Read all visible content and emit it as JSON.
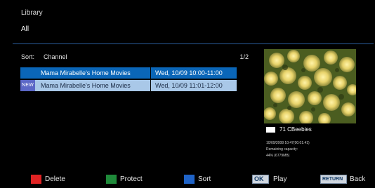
{
  "header": {
    "title": "Library",
    "filter": "All"
  },
  "sortbar": {
    "sort_key": "Sort:",
    "sort_value": "Channel",
    "page": "1/2"
  },
  "recordings": [
    {
      "badge": "",
      "name": "Mama Mirabelle's Home Movies",
      "date": "Wed, 10/09 10:00-11:00",
      "selected": true
    },
    {
      "badge": "NEW",
      "name": "Mama Mirabelle's Home Movies",
      "date": "Wed, 10/09 11:01-12:00",
      "selected": false
    }
  ],
  "info": {
    "channel": "71 CBeebies",
    "datetime": "10/09/2008 10:47(00:01:41)",
    "remaining_label": "Remaining capacity:",
    "remaining_value": "44% (6779MB)"
  },
  "footer": {
    "delete": "Delete",
    "protect": "Protect",
    "sort": "Sort",
    "ok_key": "OK",
    "play": "Play",
    "return_key": "RETURN",
    "back": "Back"
  },
  "colors": {
    "selected_row": "#0a66b8",
    "normal_row": "#a9c8e8",
    "red": "#e02323",
    "green": "#1f8a3a",
    "blue": "#1f63c7",
    "divider": "#2a5b9a"
  }
}
